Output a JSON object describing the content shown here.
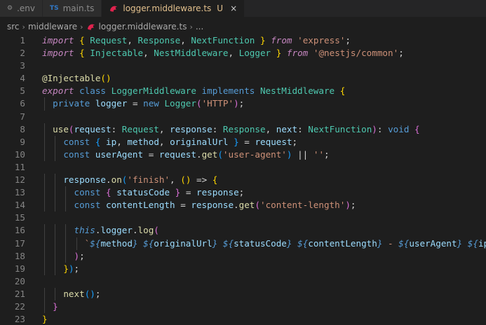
{
  "tabs": [
    {
      "label": ".env",
      "icon": "gear-icon",
      "active": false
    },
    {
      "label": "main.ts",
      "icon": "typescript-icon",
      "icon_text": "TS",
      "active": false
    },
    {
      "label": "logger.middleware.ts",
      "icon": "nestjs-icon",
      "active": true,
      "status": "U",
      "close": "×"
    }
  ],
  "breadcrumb": {
    "items": [
      "src",
      "middleware",
      "logger.middleware.ts",
      "..."
    ]
  },
  "code": {
    "line_numbers": [
      "1",
      "2",
      "3",
      "4",
      "5",
      "6",
      "7",
      "8",
      "9",
      "10",
      "11",
      "12",
      "13",
      "14",
      "15",
      "16",
      "17",
      "18",
      "19",
      "20",
      "21",
      "22",
      "23"
    ],
    "lines": [
      "import { Request, Response, NextFunction } from 'express';",
      "import { Injectable, NestMiddleware, Logger } from '@nestjs/common';",
      "",
      "@Injectable()",
      "export class LoggerMiddleware implements NestMiddleware {",
      "  private logger = new Logger('HTTP');",
      "",
      "  use(request: Request, response: Response, next: NextFunction): void {",
      "    const { ip, method, originalUrl } = request;",
      "    const userAgent = request.get('user-agent') || '';",
      "",
      "    response.on('finish', () => {",
      "      const { statusCode } = response;",
      "      const contentLength = response.get('content-length');",
      "",
      "      this.logger.log(",
      "        `${method} ${originalUrl} ${statusCode} ${contentLength} - ${userAgent} ${ip}`,",
      "      );",
      "    });",
      "",
      "    next();",
      "  }",
      "}"
    ]
  },
  "colors": {
    "background": "#1e1e1e",
    "keyword": "#c586c0",
    "type": "#4ec9b0",
    "string": "#ce9178",
    "variable": "#9cdcfe",
    "function": "#dcdcaa",
    "modified": "#e2c08d"
  }
}
